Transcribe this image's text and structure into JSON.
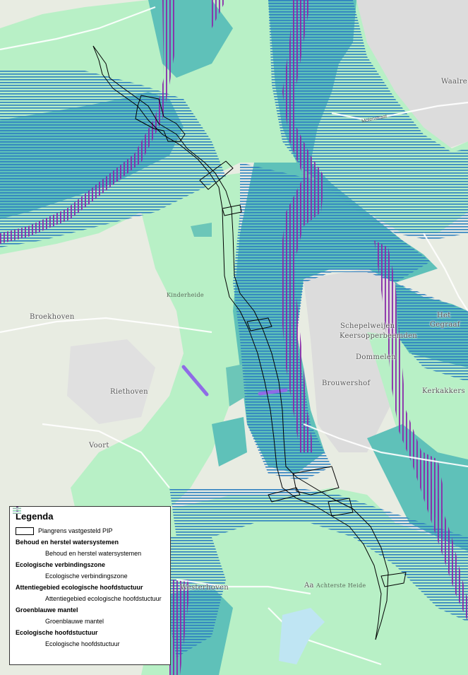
{
  "colors": {
    "ehs": "#b6f2c8",
    "gbm": "#5fc1b9",
    "attentie": "#2d7fc0",
    "gbm_stripe": "#3fb58a",
    "verbinding": "#8a2aa8",
    "water": "#6a1f8c",
    "evz_short": "#8f6be6",
    "town": "#d9d9d9",
    "road": "#ffffff",
    "pip": "#000000"
  },
  "places": [
    {
      "name": "Waalre",
      "cls": ""
    },
    {
      "name": "Het",
      "cls": ""
    },
    {
      "name": "Gegraaf",
      "cls": ""
    },
    {
      "name": "Schepelweijen",
      "cls": ""
    },
    {
      "name": "Keersopperbeemden",
      "cls": ""
    },
    {
      "name": "Dommelen",
      "cls": ""
    },
    {
      "name": "Brouwershof",
      "cls": ""
    },
    {
      "name": "Kerkakkers",
      "cls": ""
    },
    {
      "name": "Riethoven",
      "cls": ""
    },
    {
      "name": "Voort",
      "cls": ""
    },
    {
      "name": "Broekhoven",
      "cls": ""
    },
    {
      "name": "Kinderheide",
      "cls": "small"
    },
    {
      "name": "Aa",
      "cls": ""
    },
    {
      "name": "Westerhoven",
      "cls": ""
    },
    {
      "name": "Achterste Heide",
      "cls": "small"
    }
  ],
  "streets": [
    {
      "name": "Molenstraat"
    }
  ],
  "legend": {
    "title": "Legenda",
    "pip_label": "Plangrens vastgesteld PIP",
    "groups": [
      {
        "title": "Behoud en herstel watersystemen",
        "item": "Behoud en herstel watersystemen",
        "symbol": "water"
      },
      {
        "title": "Ecologische verbindingszone",
        "item": "Ecologische verbindingszone",
        "symbol": "evz"
      },
      {
        "title": "Attentiegebied ecologische hoofdstuctuur",
        "item": "Attentiegebied ecologische hoofdstuctuur",
        "symbol": "attentie"
      },
      {
        "title": "Groenblauwe mantel",
        "item": "Groenblauwe mantel",
        "symbol": "gbm"
      },
      {
        "title": "Ecologische hoofdstuctuur",
        "item": "Ecologische hoofdstuctuur",
        "symbol": "ehs"
      }
    ]
  }
}
